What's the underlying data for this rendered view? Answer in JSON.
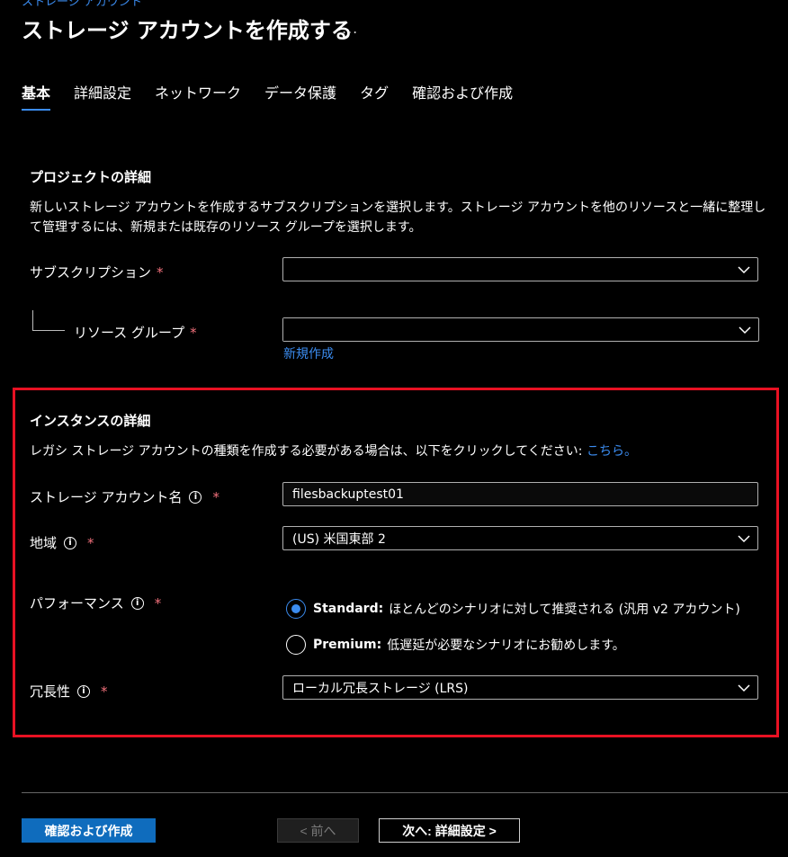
{
  "breadcrumb": "ストレージ アカウント",
  "title": "ストレージ アカウントを作成する",
  "more_label": "...",
  "tabs": [
    {
      "label": "基本",
      "active": true
    },
    {
      "label": "詳細設定"
    },
    {
      "label": "ネットワーク"
    },
    {
      "label": "データ保護"
    },
    {
      "label": "タグ"
    },
    {
      "label": "確認および作成"
    }
  ],
  "project": {
    "title": "プロジェクトの詳細",
    "description": "新しいストレージ アカウントを作成するサブスクリプションを選択します。ストレージ アカウントを他のリソースと一緒に整理して管理するには、新規または既存のリソース グループを選択します。",
    "subscription_label": "サブスクリプション",
    "subscription_value": "",
    "resource_group_label": "リソース グループ",
    "resource_group_value": "",
    "create_new_link": "新規作成"
  },
  "instance": {
    "title": "インスタンスの詳細",
    "description": "レガシ ストレージ アカウントの種類を作成する必要がある場合は、以下をクリックしてください:",
    "description_link": "こちら。",
    "name_label": "ストレージ アカウント名",
    "name_value": "filesbackuptest01",
    "region_label": "地域",
    "region_value": "(US) 米国東部 2",
    "performance_label": "パフォーマンス",
    "performance_options": [
      {
        "name": "Standard:",
        "desc": "ほとんどのシナリオに対して推奨される (汎用 v2 アカウント)",
        "checked": true
      },
      {
        "name": "Premium:",
        "desc": "低遅延が必要なシナリオにお勧めします。",
        "checked": false
      }
    ],
    "redundancy_label": "冗長性",
    "redundancy_value": "ローカル冗長ストレージ (LRS)"
  },
  "required_mark": "*",
  "info_glyph": "i",
  "footer": {
    "review_create": "確認および作成",
    "previous": "< 前へ",
    "next": "次へ: 詳細設定 >"
  },
  "colors": {
    "accent": "#3b8cf0",
    "primary_button": "#0f6cbd",
    "highlight_border": "#e81123",
    "required": "#f1707b"
  }
}
